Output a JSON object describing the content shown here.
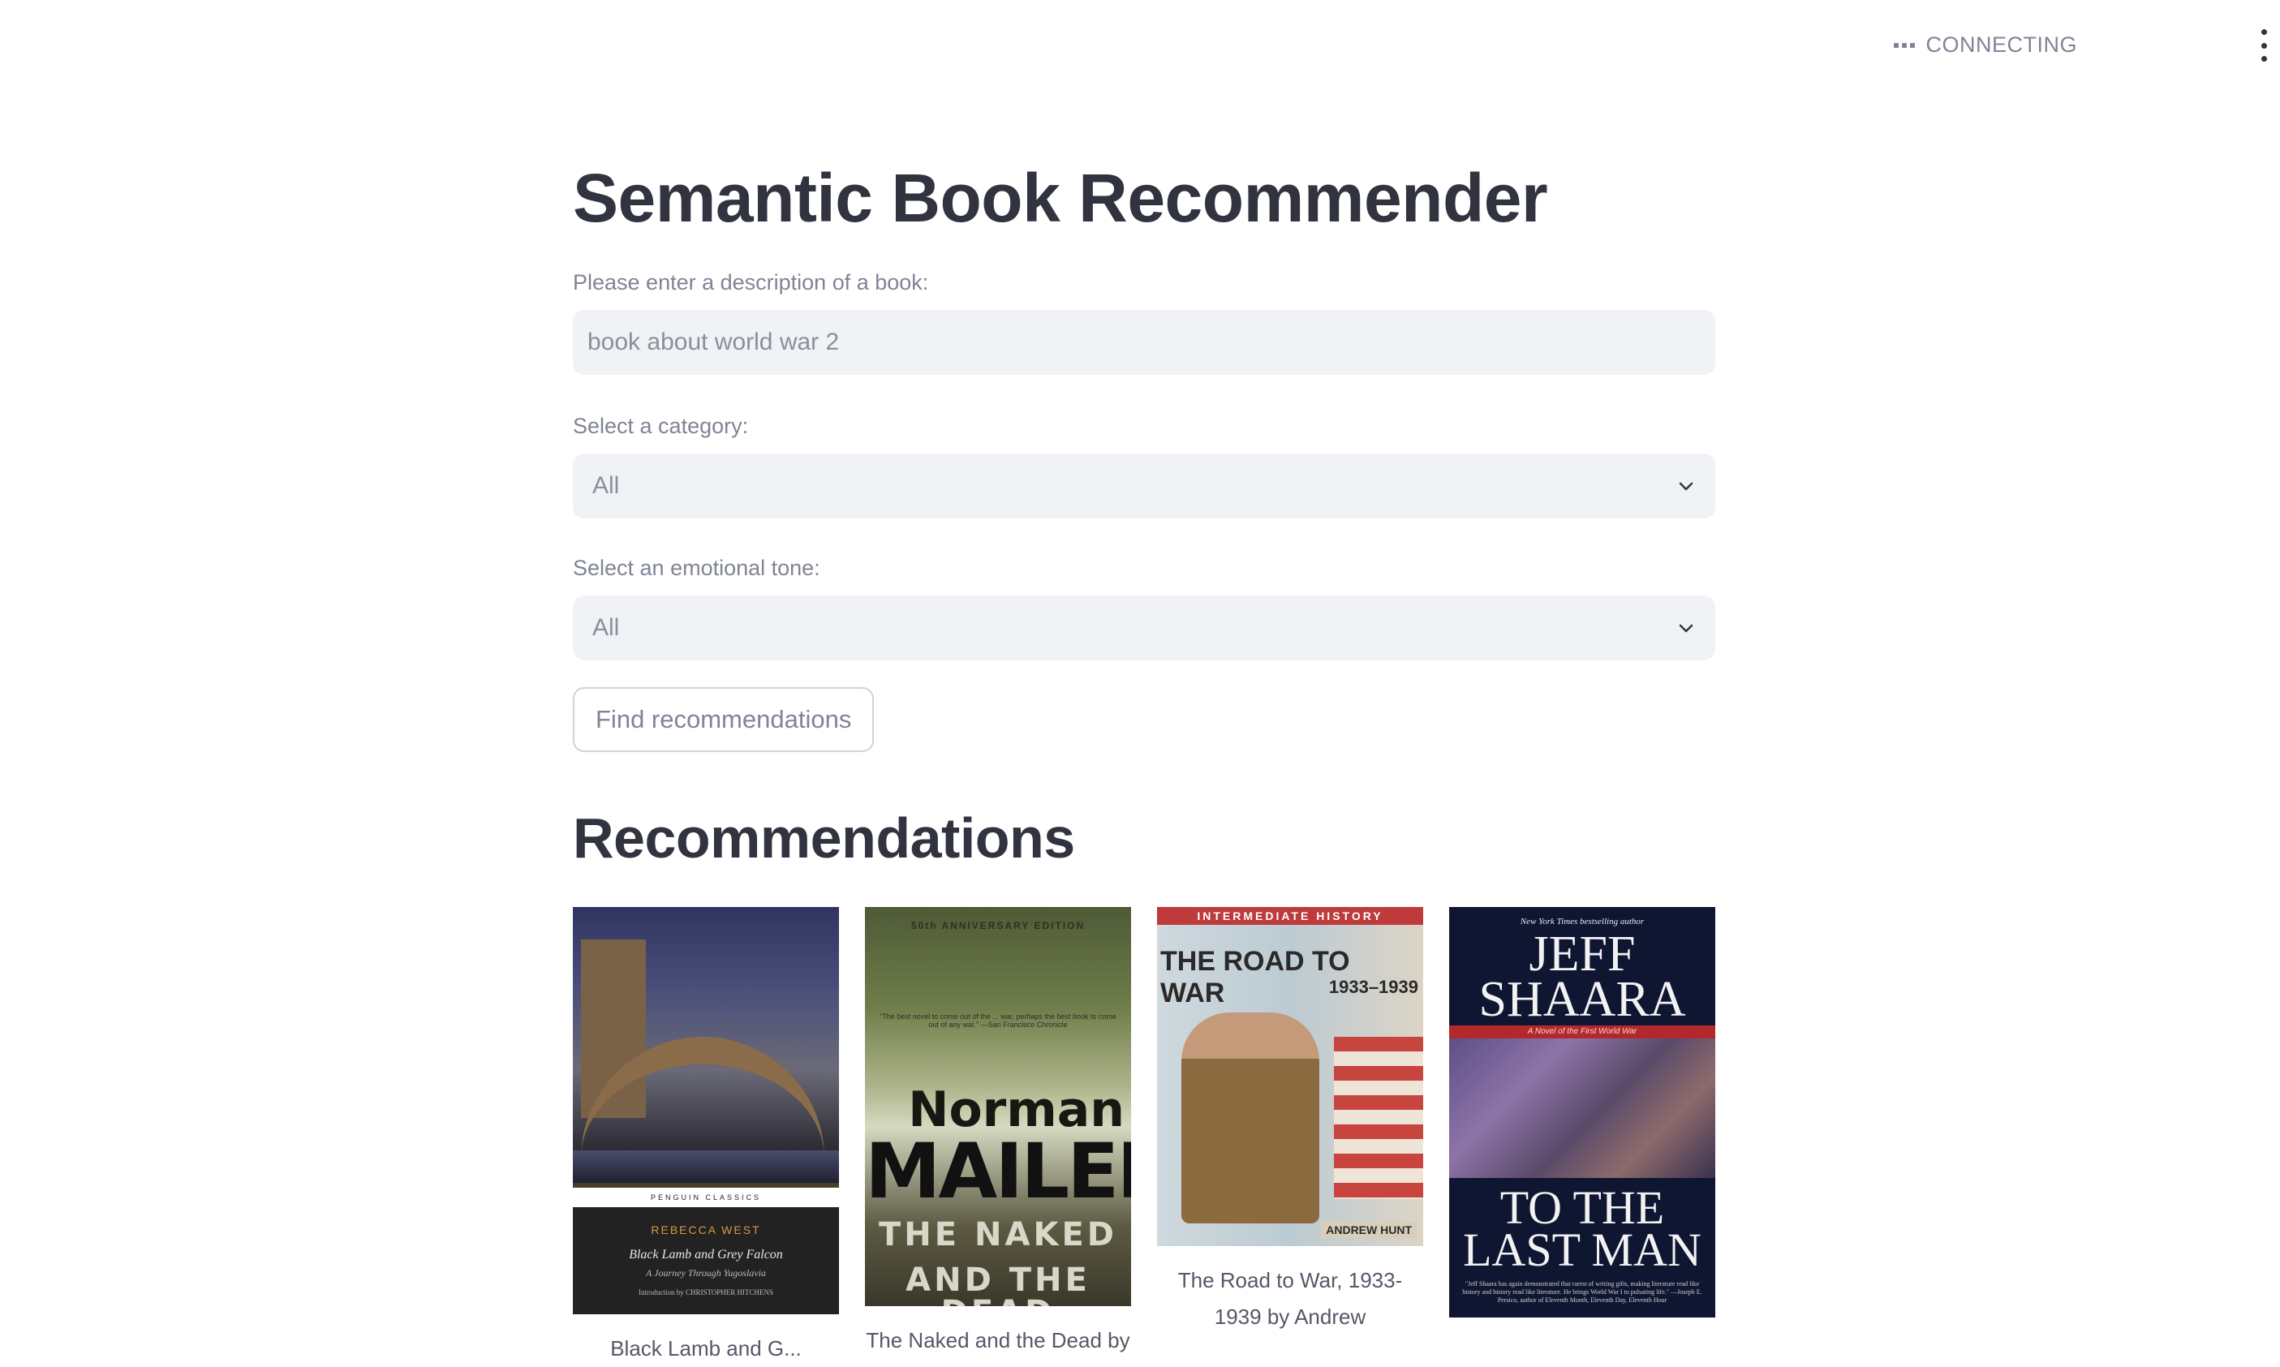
{
  "header": {
    "status_text": "CONNECTING",
    "status_icon": "dots-icon",
    "menu_icon": "vertical-ellipsis-icon"
  },
  "page": {
    "title": "Semantic Book Recommender"
  },
  "form": {
    "description_label": "Please enter a description of a book:",
    "description_value": "book about world war 2",
    "category_label": "Select a category:",
    "category_value": "All",
    "tone_label": "Select an emotional tone:",
    "tone_value": "All",
    "submit_label": "Find recommendations"
  },
  "recommendations": {
    "heading": "Recommendations",
    "items": [
      {
        "caption": "Black Lamb and G...",
        "cover": {
          "series": "PENGUIN  CLASSICS",
          "author": "REBECCA WEST",
          "title": "Black Lamb and Grey Falcon",
          "subtitle": "A Journey Through Yugoslavia",
          "intro": "Introduction by CHRISTOPHER HITCHENS"
        }
      },
      {
        "caption": "The Naked and the Dead by",
        "cover": {
          "edition": "50th ANNIVERSARY EDITION",
          "quote": "\"The best novel to come out of the ... war, perhaps the best book to come out of any war.\" —San Francisco Chronicle",
          "first": "Norman",
          "last": "MAILER",
          "title1": "THE NAKED",
          "title2": "AND THE DEAD"
        }
      },
      {
        "caption": "The Road to War, 1933-1939 by Andrew",
        "cover": {
          "strip": "INTERMEDIATE HISTORY",
          "title": "THE ROAD TO WAR",
          "years": "1933–1939",
          "author": "ANDREW HUNT"
        }
      },
      {
        "caption": "",
        "cover": {
          "tagline": "New York Times bestselling author",
          "first": "JEFF",
          "last": "SHAARA",
          "series": "A Novel of the First World War",
          "title1": "TO THE",
          "title2": "LAST MAN",
          "blurb": "\"Jeff Shaara has again demonstrated that rarest of writing gifts, making literature read like history and history read like literature. He brings World War I to pulsating life.\" —Joseph E. Persico, author of Eleventh Month, Eleventh Day, Eleventh Hour"
        }
      }
    ]
  }
}
